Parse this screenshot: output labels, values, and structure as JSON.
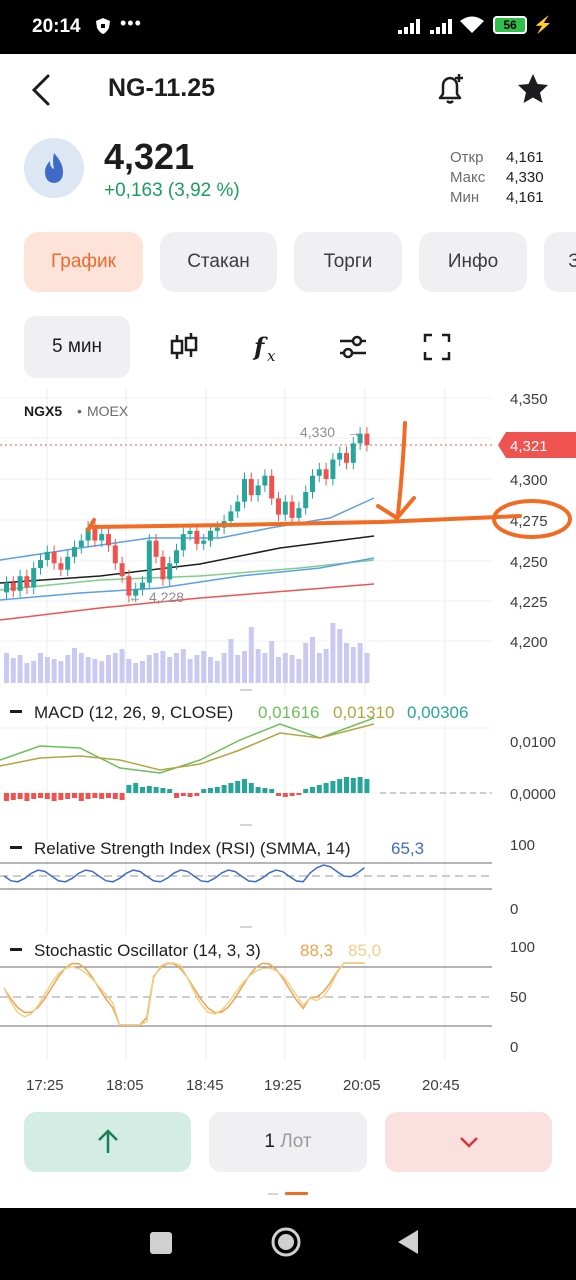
{
  "status_bar": {
    "time": "20:14",
    "battery": "56"
  },
  "header": {
    "title": "NG-11.25"
  },
  "quote": {
    "price": "4,321",
    "change": "+0,163 (3,92 %)",
    "ohl": [
      {
        "label": "Откр",
        "value": "4,161"
      },
      {
        "label": "Макс",
        "value": "4,330"
      },
      {
        "label": "Мин",
        "value": "4,161"
      }
    ]
  },
  "tabs": [
    "График",
    "Стакан",
    "Торги",
    "Инфо",
    "З"
  ],
  "toolbar": {
    "interval": "5 мин"
  },
  "chart": {
    "symbol": "NGX5",
    "exchange": "MOEX",
    "price_axis": [
      "4,350",
      "4,300",
      "4,275",
      "4,250",
      "4,225",
      "4,200"
    ],
    "current_price": "4,321",
    "high_label": "4,330",
    "low_label": "4,228",
    "macd": {
      "label": "MACD (12, 26, 9, CLOSE)",
      "v1": "0,01616",
      "v2": "0,01310",
      "v3": "0,00306",
      "axis": [
        "0,0100",
        "0,0000"
      ]
    },
    "rsi": {
      "label": "Relative Strength Index (RSI) (SMMA, 14)",
      "value": "65,3",
      "axis": [
        "100",
        "0"
      ]
    },
    "stoch": {
      "label": "Stochastic Oscillator (14, 3, 3)",
      "k": "88,3",
      "d": "85,0",
      "axis": [
        "100",
        "50",
        "0"
      ]
    },
    "time_axis": [
      "17:25",
      "18:05",
      "18:45",
      "19:25",
      "20:05",
      "20:45"
    ],
    "colors": {
      "up": "#26a69a",
      "down": "#ef5350",
      "annotation": "#f26b22",
      "volume": "#c9c9f2"
    }
  },
  "bottom": {
    "lots_number": "1",
    "lots_unit": "Лот"
  }
}
